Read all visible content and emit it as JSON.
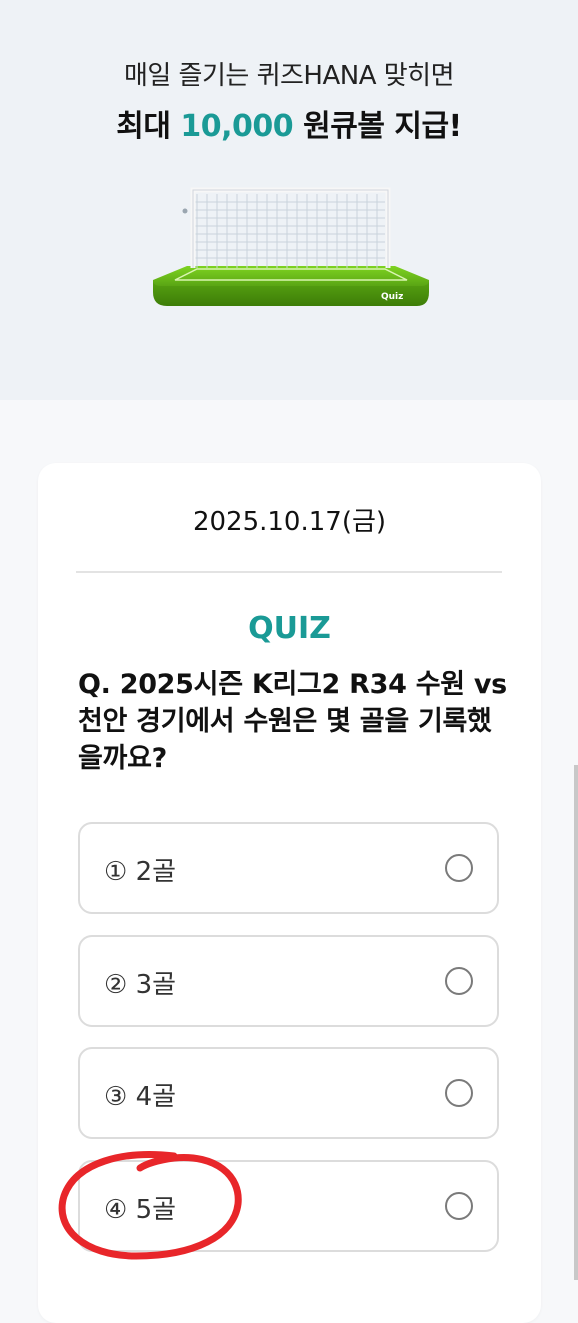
{
  "hero": {
    "line1": "매일 즐기는 퀴즈HANA 맞히면",
    "line2_prefix": "최대 ",
    "line2_accent": "10,000",
    "line2_suffix": " 원큐볼 지급!",
    "goal_label": "Quiz"
  },
  "card": {
    "date": "2025.10.17(금)",
    "quiz_title": "QUIZ",
    "question": "Q. 2025시즌 K리그2 R34 수원 vs 천안 경기에서 수원은 몇 골을 기록했을까요?"
  },
  "options": [
    {
      "label": "① 2골"
    },
    {
      "label": "② 3골"
    },
    {
      "label": "③ 4골"
    },
    {
      "label": "④ 5골"
    }
  ],
  "colors": {
    "accent": "#1a9a96",
    "hero_bg": "#eef2f6",
    "annotation_red": "#e8262a"
  }
}
